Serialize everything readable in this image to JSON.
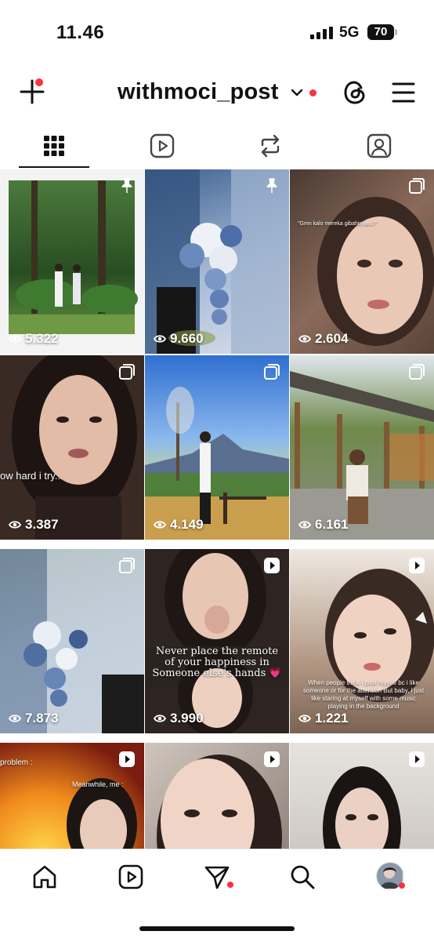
{
  "status_bar": {
    "time": "11.46",
    "network": "5G",
    "battery": "70"
  },
  "header": {
    "username": "withmoci_post"
  },
  "profile_tabs": [
    {
      "icon": "grid-icon"
    },
    {
      "icon": "reels-icon"
    },
    {
      "icon": "reposts-icon"
    },
    {
      "icon": "tagged-icon"
    }
  ],
  "posts": [
    {
      "views": "5.322",
      "badge": "pin-icon"
    },
    {
      "views": "9.660",
      "badge": "pin-icon"
    },
    {
      "views": "2.604",
      "badge": "carousel-icon",
      "caption": "\"Gmn kalo mereka gibahin aku?\""
    },
    {
      "views": "3.387",
      "badge": "carousel-icon",
      "caption": "ow hard i try..."
    },
    {
      "views": "4.149",
      "badge": "carousel-icon"
    },
    {
      "views": "6.161",
      "badge": "carousel-icon"
    },
    {
      "views": "7.873",
      "badge": "carousel-icon"
    },
    {
      "views": "3.990",
      "badge": "reel-icon",
      "caption": "Never place the remote of your happiness in Someone else's hands 💗"
    },
    {
      "views": "1.221",
      "badge": "reel-icon",
      "caption": "When people think i post myself bc i like someone or for the attention But baby, i just like staring at myself with some music playing in the background"
    },
    {
      "badge": "reel-icon",
      "caption": "problem :",
      "caption2": "Meanwhile, me :"
    },
    {
      "badge": "reel-icon"
    },
    {
      "badge": "reel-icon"
    }
  ],
  "bottom_nav": [
    {
      "icon": "home-icon"
    },
    {
      "icon": "reels-icon"
    },
    {
      "icon": "direct-messages-icon"
    },
    {
      "icon": "search-icon"
    },
    {
      "icon": "profile-avatar"
    }
  ],
  "colors": {
    "notification": "#ff3040",
    "text": "#111111",
    "background": "#ffffff"
  }
}
